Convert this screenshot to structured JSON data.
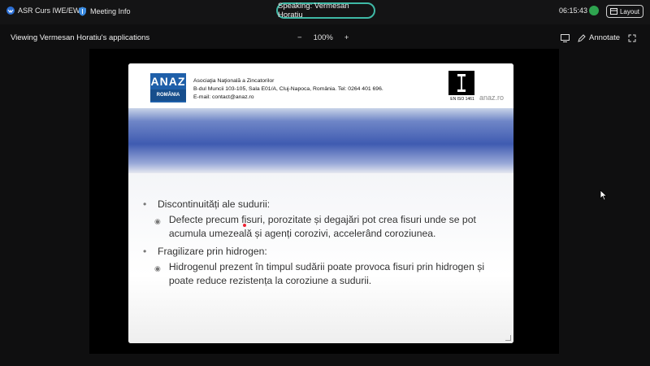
{
  "topbar": {
    "meeting_title": "ASR Curs IWE/EWE",
    "meeting_info": "Meeting Info",
    "speaking": "Speaking: Vermesan Horatiu",
    "clock": "06:15:43",
    "layout": "Layout"
  },
  "viewbar": {
    "viewing": "Viewing Vermesan Horatiu's applications",
    "zoom_minus": "−",
    "zoom_level": "100%",
    "zoom_plus": "+",
    "annotate": "Annotate"
  },
  "slide": {
    "logo_top": "ANAZ",
    "logo_bottom": "ROMÂNIA",
    "org_name": "Asociaţia Naţională a Zincatorilor",
    "org_address": "B-dul Muncii 103-105, Sala E01/A, Cluj-Napoca, România. Tel: 0264 401 696.",
    "org_email": "E-mail: contact@anaz.ro",
    "iso": "EN ISO 1461",
    "site": "anaz.ro",
    "bullets": [
      {
        "title": "Discontinuități ale sudurii:",
        "sub": "Defecte precum fisuri, porozitate și degajări pot crea fisuri unde se pot acumula umezeală și agenți corozivi, accelerând coroziunea."
      },
      {
        "title": "Fragilizare prin hidrogen:",
        "sub": "Hidrogenul prezent în timpul sudării poate provoca fisuri prin hidrogen și poate reduce rezistența la coroziune a sudurii."
      }
    ]
  },
  "colors": {
    "speaking_border": "#3fb9a6",
    "status": "#2ea44f",
    "logo_blue": "#1e5fa9"
  }
}
